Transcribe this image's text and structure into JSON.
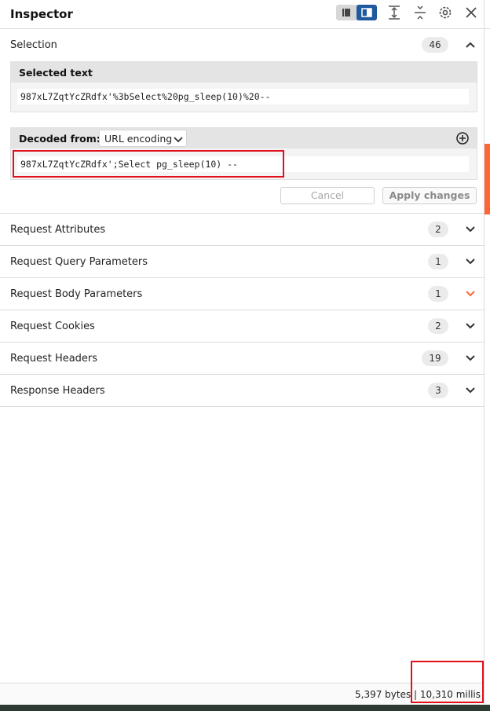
{
  "header": {
    "title": "Inspector",
    "icons": [
      "layout-list-icon",
      "layout-split-icon",
      "expand-all-icon",
      "collapse-all-icon",
      "gear-icon",
      "close-icon"
    ]
  },
  "selection": {
    "label": "Selection",
    "count": "46",
    "selected_text": {
      "title": "Selected text",
      "value": "987xL7ZqtYcZRdfx'%3bSelect%20pg_sleep(10)%20--"
    },
    "decoded": {
      "title": "Decoded from:",
      "encoding": "URL encoding",
      "value": "987xL7ZqtYcZRdfx';Select pg_sleep(10) --"
    },
    "cancel_label": "Cancel",
    "apply_label": "Apply changes"
  },
  "sections": [
    {
      "label": "Request Attributes",
      "count": "2"
    },
    {
      "label": "Request Query Parameters",
      "count": "1"
    },
    {
      "label": "Request Body Parameters",
      "count": "1"
    },
    {
      "label": "Request Cookies",
      "count": "2"
    },
    {
      "label": "Request Headers",
      "count": "19"
    },
    {
      "label": "Response Headers",
      "count": "3"
    }
  ],
  "status": {
    "text": "5,397 bytes | 10,310 millis"
  },
  "colors": {
    "accent": "#ff6633",
    "toggle_active": "#1f5a9f",
    "highlight_box": "#e0101c"
  }
}
